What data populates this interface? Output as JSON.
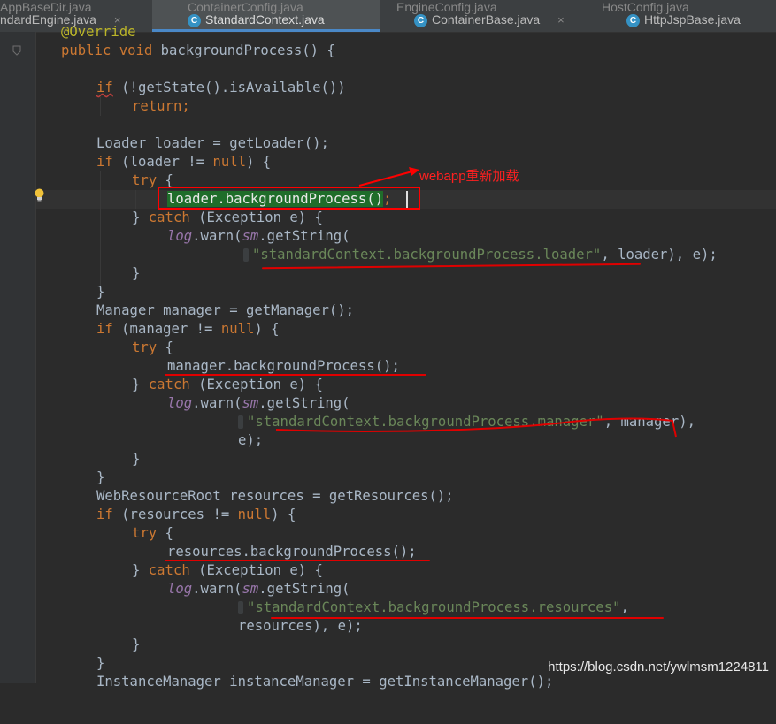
{
  "tabs": [
    {
      "label": "ndardEngine.java",
      "ghost": "",
      "icon": false,
      "active": false
    },
    {
      "label": "StandardContext.java",
      "ghost": "ContainerConfig.java",
      "icon": true,
      "active": true
    },
    {
      "label": "ContainerBase.java",
      "ghost": "EngineConfig.java",
      "icon": true,
      "active": false
    },
    {
      "label": "HttpJspBase.java",
      "ghost": "HostConfig.java",
      "icon": true,
      "active": false
    }
  ],
  "tab_ghost_first": "AppBaseDir.java",
  "icon_letter": "C",
  "close_glyph": "×",
  "code": {
    "l0": "@Override",
    "l1_kw": "public void ",
    "l1_rest": "backgroundProcess() {",
    "l2_kw": "if",
    "l2_rest": " (!getState().isAvailable())",
    "l3_kw": "return",
    "l3_rest": ";",
    "l4": "Loader loader = getLoader();",
    "l5_kw": "if",
    "l5_a": " (loader != ",
    "l5_null": "null",
    "l5_b": ") {",
    "l6_kw": "try",
    "l6_rest": " {",
    "l7_hl": "loader.backgroundProcess()",
    "l7_rest": ";",
    "l8_a": "} ",
    "l8_kw": "catch",
    "l8_b": " (Exception e) {",
    "l9_log": "log",
    "l9_a": ".warn(",
    "l9_sm": "sm",
    "l9_b": ".getString(",
    "hint_key": "key:",
    "l10_str": "\"standardContext.backgroundProcess.loader\"",
    "l10_rest": ", loader), e);",
    "l11": "}",
    "l12": "}",
    "l13": "Manager manager = getManager();",
    "l14_kw": "if",
    "l14_a": " (manager != ",
    "l14_null": "null",
    "l14_b": ") {",
    "l15_kw": "try",
    "l15_rest": " {",
    "l16": "manager.backgroundProcess();",
    "l17_a": "} ",
    "l17_kw": "catch",
    "l17_b": " (Exception e) {",
    "l18_log": "log",
    "l18_a": ".warn(",
    "l18_sm": "sm",
    "l18_b": ".getString(",
    "l19_str": "\"standardContext.backgroundProcess.manager\"",
    "l19_rest": ", manager),",
    "l20": "e);",
    "l21": "}",
    "l22": "}",
    "l23": "WebResourceRoot resources = getResources();",
    "l24_kw": "if",
    "l24_a": " (resources != ",
    "l24_null": "null",
    "l24_b": ") {",
    "l25_kw": "try",
    "l25_rest": " {",
    "l26": "resources.backgroundProcess();",
    "l27_a": "} ",
    "l27_kw": "catch",
    "l27_b": " (Exception e) {",
    "l28_log": "log",
    "l28_a": ".warn(",
    "l28_sm": "sm",
    "l28_b": ".getString(",
    "l29_str": "\"standardContext.backgroundProcess.resources\"",
    "l29_rest": ",",
    "l30": "resources), e);",
    "l31": "}",
    "l32": "}",
    "l33": "InstanceManager instanceManager = getInstanceManager();"
  },
  "annotation": "webapp重新加载",
  "watermark": "https://blog.csdn.net/ywlmsm1224811",
  "colors": {
    "keyword": "#cc7832",
    "string": "#6a8759",
    "annotation_red": "#ff0000",
    "active_tab_underline": "#4a88c7"
  }
}
